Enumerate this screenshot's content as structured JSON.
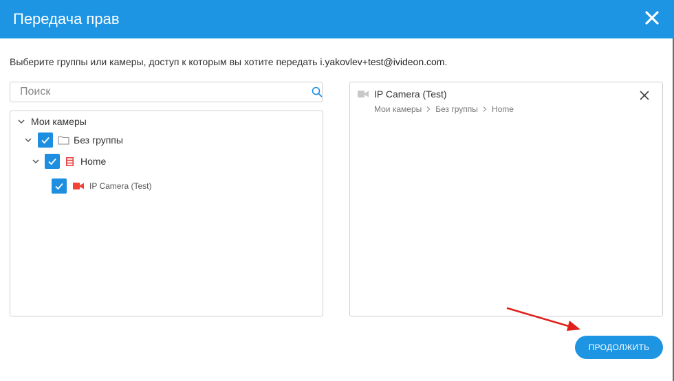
{
  "dialog": {
    "title": "Передача прав",
    "close_icon": "close-icon"
  },
  "instruction": {
    "text": "Выберите группы или камеры, доступ к которым вы хотите передать ",
    "email": "i.yakovlev+test@ivideon.com",
    "suffix": "."
  },
  "search": {
    "placeholder": "Поиск",
    "value": "",
    "icon": "search-icon"
  },
  "tree": {
    "root": {
      "label": "Мои камеры",
      "expanded": true
    },
    "group": {
      "label": "Без группы",
      "checked": true,
      "expanded": true,
      "icon": "folder-icon"
    },
    "server": {
      "label": "Home",
      "checked": true,
      "expanded": true,
      "icon": "server-icon"
    },
    "camera": {
      "label": "IP Camera (Test)",
      "checked": true,
      "icon": "camera-icon"
    }
  },
  "selected": {
    "items": [
      {
        "title": "IP Camera (Test)",
        "path": [
          "Мои камеры",
          "Без группы",
          "Home"
        ],
        "icon": "camera-icon"
      }
    ]
  },
  "actions": {
    "continue_label": "ПРОДОЛЖИТЬ"
  },
  "colors": {
    "header": "#1e95e3",
    "checkbox": "#1e8fe0",
    "server_icon": "#e53935",
    "camera_icon": "#f44336",
    "annotation_arrow": "#e0201a"
  }
}
